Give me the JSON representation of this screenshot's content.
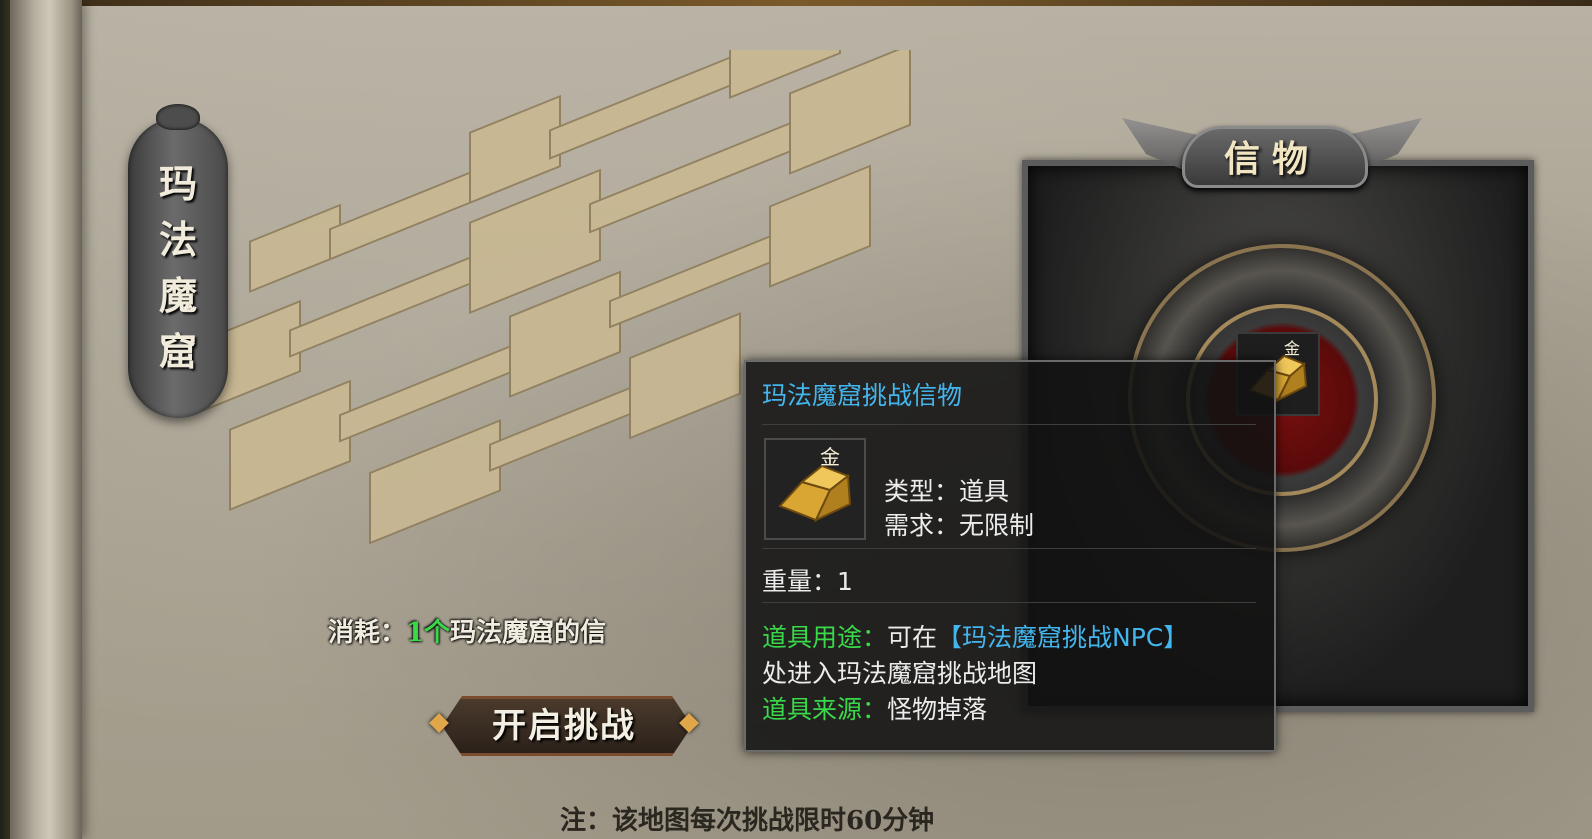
{
  "dungeon": {
    "title_chars": [
      "玛",
      "法",
      "魔",
      "窟"
    ]
  },
  "cost": {
    "label": "消耗：",
    "amount": "1个",
    "item_partial": "玛法魔窟的信"
  },
  "start_button": {
    "label": "开启挑战"
  },
  "note": {
    "text": "注：该地图每次挑战限时60分钟"
  },
  "token_panel": {
    "header": "信物",
    "slot_glyph": "金"
  },
  "tooltip": {
    "title": "玛法魔窟挑战信物",
    "slot_glyph": "金",
    "type": "类型：道具",
    "requirement": "需求：无限制",
    "weight": "重量：1",
    "use_label": "道具用途：",
    "use_text_1": "可在",
    "use_npc": "【玛法魔窟挑战NPC】",
    "use_text_2": "处进入玛法魔窟挑战地图",
    "source_label": "道具来源：",
    "source_text": "怪物掉落"
  },
  "colors": {
    "tooltip_title": "#44b6ee",
    "highlight_green": "#39d94a",
    "parchment": "#aaa393"
  },
  "icons": [
    "gold-ingot-icon",
    "wing-ornament-icon",
    "diamond-gem-icon"
  ]
}
